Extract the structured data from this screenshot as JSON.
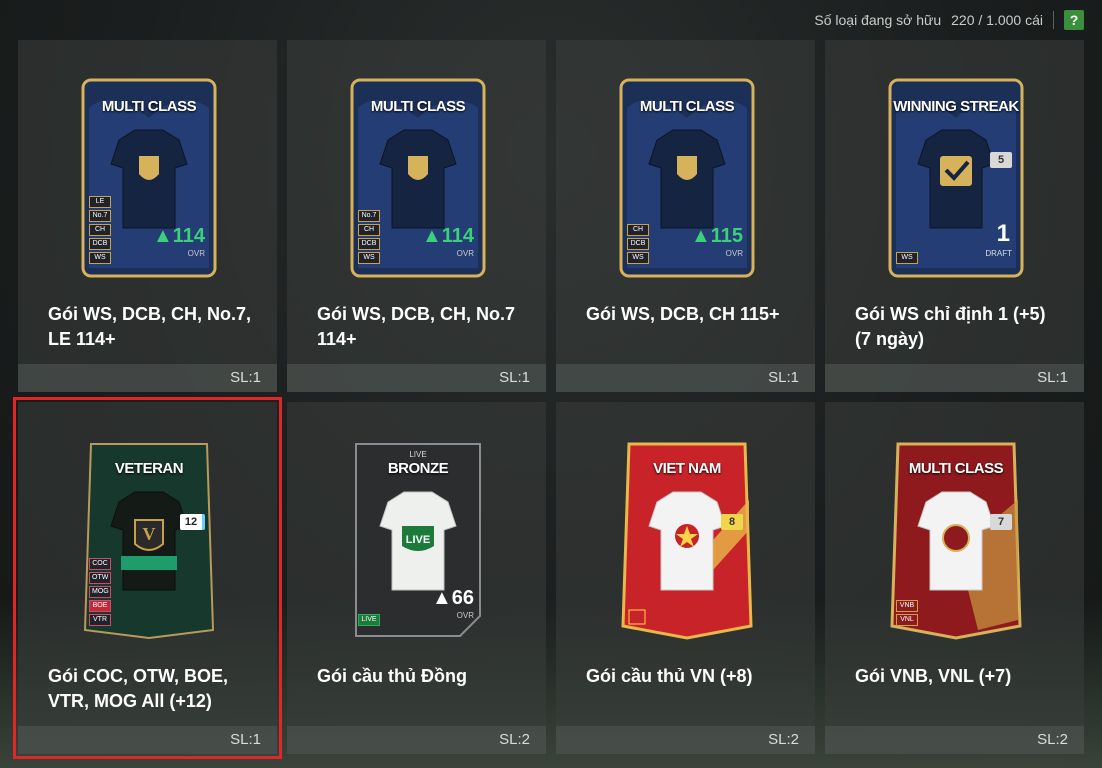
{
  "header": {
    "owned_label": "Số loại đang sở hữu",
    "owned_count": "220 / 1.000 cái",
    "help": "?"
  },
  "packs": [
    {
      "title": "Gói WS, DCB, CH, No.7, LE 114+",
      "qty": "SL:1",
      "card_label": "MULTI CLASS",
      "ovr": "114",
      "ovr_label": "OVR",
      "badges": [
        "LE",
        "No.7",
        "CH",
        "DCB",
        "WS"
      ]
    },
    {
      "title": "Gói WS, DCB, CH, No.7 114+",
      "qty": "SL:1",
      "card_label": "MULTI CLASS",
      "ovr": "114",
      "ovr_label": "OVR",
      "badges": [
        "No.7",
        "CH",
        "DCB",
        "WS"
      ]
    },
    {
      "title": "Gói WS, DCB, CH 115+",
      "qty": "SL:1",
      "card_label": "MULTI CLASS",
      "ovr": "115",
      "ovr_label": "OVR",
      "badges": [
        "CH",
        "DCB",
        "WS"
      ]
    },
    {
      "title": "Gói WS chỉ định 1 (+5) (7 ngày)",
      "qty": "SL:1",
      "card_label": "WINNING STREAK",
      "tag": "5",
      "draft": "1",
      "draft_label": "DRAFT",
      "badges": [
        "WS"
      ]
    },
    {
      "title": "Gói COC, OTW, BOE, VTR, MOG All (+12)",
      "qty": "SL:1",
      "card_label": "VETERAN",
      "tag": "12",
      "badges": [
        "COC",
        "OTW",
        "MOG",
        "BOE",
        "VTR"
      ]
    },
    {
      "title": "Gói cầu thủ Đồng",
      "qty": "SL:2",
      "card_sub": "LIVE",
      "card_label": "BRONZE",
      "ovr": "66",
      "ovr_label": "OVR",
      "badges": [
        "LIVE"
      ]
    },
    {
      "title": "Gói cầu thủ VN (+8)",
      "qty": "SL:2",
      "card_label": "VIET NAM",
      "tag": "8",
      "badges": []
    },
    {
      "title": "Gói VNB, VNL (+7)",
      "qty": "SL:2",
      "card_label": "MULTI CLASS",
      "tag": "7",
      "badges": [
        "VNB",
        "VNL"
      ]
    }
  ],
  "colors": {
    "selected_border": "#e02626",
    "ovr_green": "#3bd07a",
    "help_green": "#3a8f3c"
  }
}
